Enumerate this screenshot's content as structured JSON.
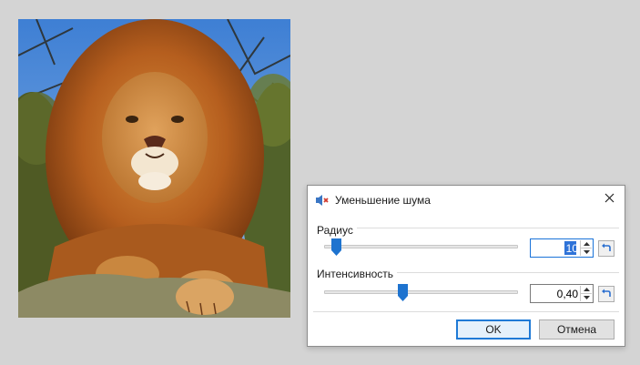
{
  "photo": {
    "subject_icon": "lion-photo"
  },
  "dialog": {
    "title": "Уменьшение шума",
    "title_icon": "speaker-mute-icon",
    "close_icon": "close-icon",
    "radius": {
      "label": "Радиус",
      "value": "10",
      "slider_fraction": 0.07
    },
    "intensity": {
      "label": "Интенсивность",
      "value": "0,40",
      "slider_fraction": 0.4
    },
    "ok_label": "OK",
    "cancel_label": "Отмена",
    "colors": {
      "accent": "#1a73d9",
      "thumb": "#1e73cf"
    }
  }
}
